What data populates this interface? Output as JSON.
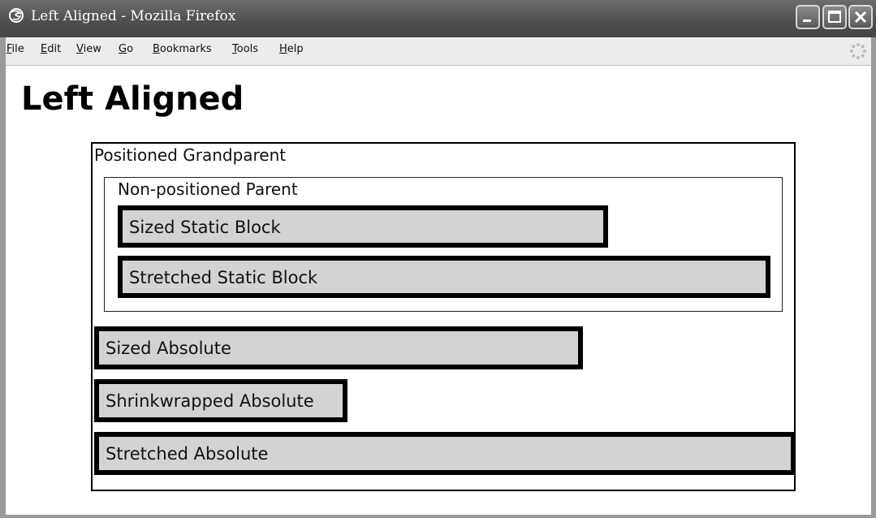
{
  "window": {
    "title": "Left Aligned - Mozilla Firefox"
  },
  "menu": {
    "items": [
      "File",
      "Edit",
      "View",
      "Go",
      "Bookmarks",
      "Tools",
      "Help"
    ]
  },
  "page": {
    "heading": "Left Aligned",
    "grandparent_label": "Positioned Grandparent",
    "parent_label": "Non-positioned Parent",
    "blocks": {
      "sized_static": "Sized Static Block",
      "stretched_static": "Stretched Static Block",
      "sized_absolute": "Sized Absolute",
      "shrinkwrapped_absolute": "Shrinkwrapped Absolute",
      "stretched_absolute": "Stretched Absolute"
    }
  },
  "icons": {
    "title": "firefox-icon",
    "minimize": "minimize-icon",
    "maximize": "maximize-icon",
    "close": "close-icon",
    "throbber": "throbber-icon"
  },
  "colors": {
    "titlebar": "#4e4e4e",
    "menubar": "#ececec",
    "block_fill": "#d3d3d3",
    "block_border": "#000000"
  }
}
